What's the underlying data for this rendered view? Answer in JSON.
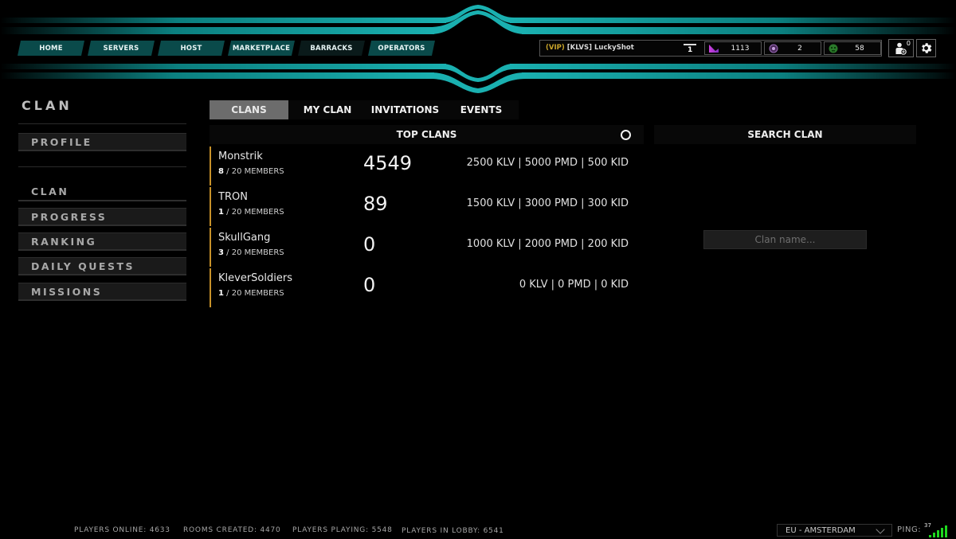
{
  "nav": {
    "items": [
      {
        "label": "HOME"
      },
      {
        "label": "SERVERS"
      },
      {
        "label": "HOST"
      },
      {
        "label": "MARKETPLACE"
      },
      {
        "label": "BARRACKS"
      },
      {
        "label": "OPERATORS"
      }
    ]
  },
  "user": {
    "vip_tag": "(VIP)",
    "clan_tag": "[KLVS]",
    "name": "LuckyShot",
    "rank": "1",
    "stats": [
      {
        "icon": "klv-currency-icon",
        "value": "1113",
        "color": "#c040d0"
      },
      {
        "icon": "pmd-token-icon",
        "value": "2",
        "color": "#8a5aa8"
      },
      {
        "icon": "kid-token-icon",
        "value": "58",
        "color": "#3a9a3a"
      }
    ],
    "friend_requests": "0"
  },
  "sidebar": {
    "title": "CLAN",
    "items": [
      {
        "label": "PROFILE"
      },
      {
        "label": "CLAN"
      },
      {
        "label": "PROGRESS"
      },
      {
        "label": "RANKING"
      },
      {
        "label": "DAILY QUESTS"
      },
      {
        "label": "MISSIONS"
      }
    ]
  },
  "tabs": [
    {
      "label": "CLANS",
      "active": true
    },
    {
      "label": "MY CLAN",
      "active": false
    },
    {
      "label": "INVITATIONS",
      "active": false
    },
    {
      "label": "EVENTS",
      "active": false
    }
  ],
  "top_clans": {
    "title": "TOP CLANS",
    "rows": [
      {
        "name": "Monstrik",
        "members": "8",
        "max_members": "/ 20 MEMBERS",
        "score": "4549",
        "rewards": "2500 KLV | 5000 PMD | 500 KID"
      },
      {
        "name": "TRON",
        "members": "1",
        "max_members": "/ 20 MEMBERS",
        "score": "89",
        "rewards": "1500 KLV | 3000 PMD | 300 KID"
      },
      {
        "name": "SkullGang",
        "members": "3",
        "max_members": "/ 20 MEMBERS",
        "score": "0",
        "rewards": "1000 KLV | 2000 PMD | 200 KID"
      },
      {
        "name": "KleverSoldiers",
        "members": "1",
        "max_members": "/ 20 MEMBERS",
        "score": "0",
        "rewards": "0 KLV | 0 PMD | 0 KID"
      }
    ]
  },
  "search_clan": {
    "title": "SEARCH CLAN",
    "placeholder": "Clan name...",
    "value": ""
  },
  "footer": {
    "players_online": "PLAYERS ONLINE: 4633",
    "rooms_created": "ROOMS CREATED: 4470",
    "players_playing": "PLAYERS PLAYING: 5548",
    "players_in_lobby": "PLAYERS IN LOBBY: 6541",
    "region": "EU - AMSTERDAM",
    "ping_label": "PING:",
    "ping_value": "37"
  },
  "colors": {
    "accent_teal": "#18b4b4",
    "clan_row_border": "#c8922a",
    "vip_gold": "#c8a42a",
    "signal_green": "#1ed81e"
  }
}
